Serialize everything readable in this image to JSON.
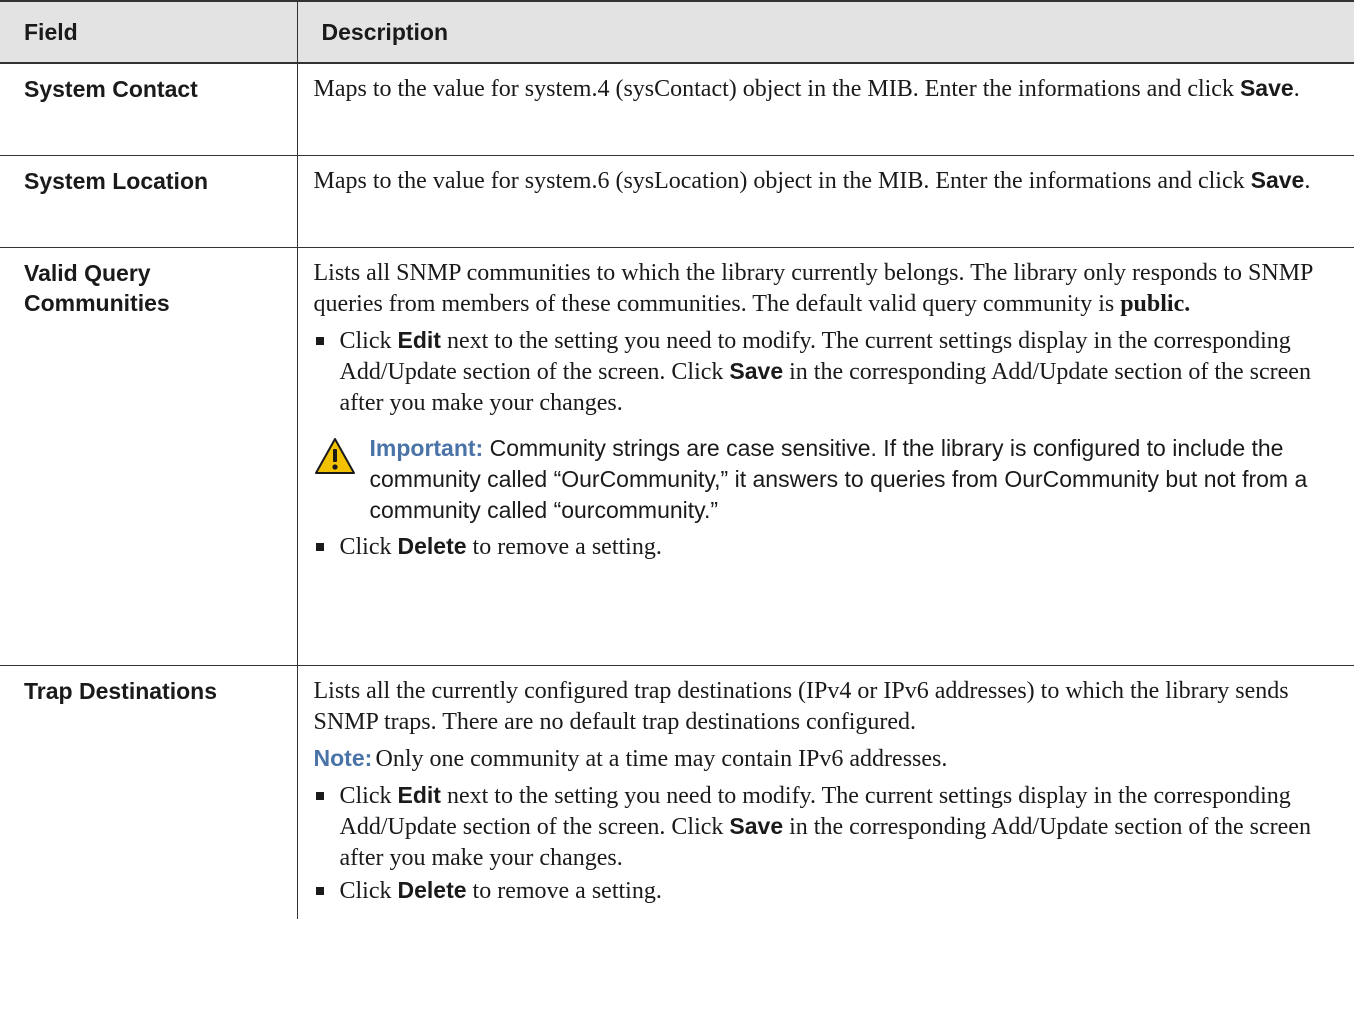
{
  "header": {
    "field": "Field",
    "description": "Description"
  },
  "rows": {
    "contact": {
      "field": "System Contact",
      "desc_a": "Maps to the value for system.4 (sysContact) object in the MIB. Enter the informations and click ",
      "save": "Save",
      "desc_b": "."
    },
    "location": {
      "field": "System Location",
      "desc_a": "Maps to the value for system.6 (sysLocation) object in the MIB. Enter the informations and click ",
      "save": "Save",
      "desc_b": "."
    },
    "query": {
      "field": "Valid Query Communities",
      "desc_a": "Lists all SNMP communities to which the library currently belongs. The library only responds to SNMP queries from members of these communities. The default valid query community is ",
      "public": "public.",
      "edit_a": "Click ",
      "edit_kw": "Edit",
      "edit_b": " next to the setting you need to modify. The current settings display in the corresponding Add/Update section of the screen. Click ",
      "save_kw": "Save",
      "edit_c": " in the corresponding Add/Update section of the screen after you make your changes.",
      "important_label": "Important:",
      "important_text": " Community strings are case sensitive. If the library is configured to include the community called “OurCommunity,” it answers to queries from OurCommunity but not from a community called “ourcommunity.”",
      "delete_a": "Click ",
      "delete_kw": "Delete",
      "delete_b": " to remove a setting."
    },
    "trap": {
      "field": "Trap Destinations",
      "desc_a": "Lists all the currently configured trap destinations (IPv4 or IPv6 addresses) to which the library sends SNMP traps. There are no default trap destinations configured.",
      "note_label": "Note:",
      "note_text": "Only one community at a time may contain IPv6 addresses.",
      "edit_a": "Click ",
      "edit_kw": "Edit",
      "edit_b": " next to the setting you need to modify. The current settings display in the corresponding Add/Update section of the screen. Click ",
      "save_kw": "Save",
      "edit_c": " in the corresponding Add/Update section of the screen after you make your changes.",
      "delete_a": "Click ",
      "delete_kw": "Delete",
      "delete_b": " to remove a setting."
    }
  },
  "icons": {
    "important": "warning-triangle-icon",
    "bullet": "square-bullet-icon"
  },
  "colors": {
    "header_bg": "#e3e3e3",
    "label_blue": "#4a73a8",
    "warning_yellow": "#f2c200"
  }
}
